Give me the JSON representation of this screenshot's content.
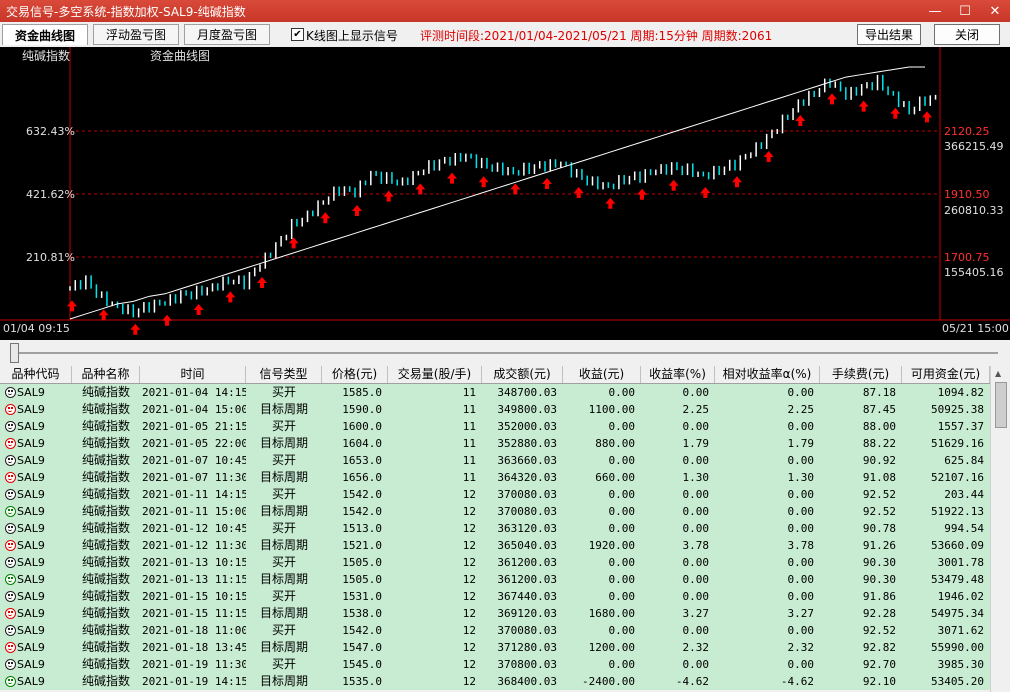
{
  "window": {
    "title": "交易信号-多空系统-指数加权-SAL9-纯碱指数",
    "minimize": "—",
    "maximize": "☐",
    "close": "✕"
  },
  "toolbar": {
    "tabs": [
      {
        "label": "资金曲线图"
      },
      {
        "label": "浮动盈亏图"
      },
      {
        "label": "月度盈亏图"
      }
    ],
    "checkbox_checked": "✔",
    "checkbox_label": "K线图上显示信号",
    "period_info": "评测时间段:2021/01/04-2021/05/21  周期:15分钟  周期数:2061",
    "export_label": "导出结果",
    "close_label": "关闭"
  },
  "chart": {
    "left_title": "纯碱指数",
    "center_title": "资金曲线图",
    "left_ticks": [
      "632.43%",
      "421.62%",
      "210.81%"
    ],
    "right_price_ticks": [
      "2120.25",
      "1910.50",
      "1700.75"
    ],
    "right_equity_ticks": [
      "366215.49",
      "260810.33",
      "155405.16"
    ],
    "start_label": "01/04 09:15",
    "end_label": "05/21 15:00",
    "colors": {
      "up": "#ffffff",
      "down": "#00e5ee",
      "equity": "#ffffff",
      "grid": "#c00000",
      "signal": "#ff0000"
    }
  },
  "chart_data": {
    "type": "line",
    "series": [
      {
        "values": [
          1585,
          1605,
          1560,
          1535,
          1520,
          1535,
          1545,
          1565,
          1575,
          1590,
          1610,
          1600,
          1650,
          1700,
          1760,
          1790,
          1830,
          1860,
          1850,
          1900,
          1890,
          1880,
          1910,
          1930,
          1940,
          1950,
          1930,
          1920,
          1910,
          1920,
          1925,
          1930,
          1900,
          1880,
          1870,
          1890,
          1895,
          1910,
          1920,
          1915,
          1900,
          1915,
          1930,
          1960,
          2000,
          2050,
          2100,
          2130,
          2160,
          2120,
          2140,
          2160,
          2120,
          2080,
          2110
        ]
      },
      {
        "values": [
          0.0,
          0.02,
          0.04,
          0.06,
          0.07,
          0.09,
          0.1,
          0.12,
          0.14,
          0.16,
          0.18,
          0.2,
          0.22,
          0.24,
          0.26,
          0.28,
          0.3,
          0.32,
          0.34,
          0.36,
          0.38,
          0.4,
          0.42,
          0.44,
          0.46,
          0.48,
          0.5,
          0.52,
          0.54,
          0.56,
          0.58,
          0.6,
          0.62,
          0.64,
          0.66,
          0.68,
          0.7,
          0.72,
          0.74,
          0.76,
          0.78,
          0.8,
          0.82,
          0.84,
          0.86,
          0.88,
          0.9,
          0.92,
          0.94,
          0.96,
          0.97,
          0.98,
          0.99,
          1.0,
          1.0
        ]
      }
    ],
    "xlabel": "",
    "ylabel": ""
  },
  "table": {
    "headers": [
      "品种代码",
      "品种名称",
      "时间",
      "信号类型",
      "价格(元)",
      "交易量(股/手)",
      "成交额(元)",
      "收益(元)",
      "收益率(%)",
      "相对收益率α(%)",
      "手续费(元)",
      "可用资金(元)"
    ],
    "rows": [
      {
        "face": "black",
        "code": "SAL9",
        "name": "纯碱指数",
        "time": "2021-01-04 14:15",
        "type": "买开",
        "price": "1585.0",
        "qty": "11",
        "amount": "348700.03",
        "profit": "0.00",
        "rate": "0.00",
        "alpha": "0.00",
        "fee": "87.18",
        "cash": "1094.82"
      },
      {
        "face": "red",
        "code": "SAL9",
        "name": "纯碱指数",
        "time": "2021-01-04 15:00",
        "type": "目标周期",
        "price": "1590.0",
        "qty": "11",
        "amount": "349800.03",
        "profit": "1100.00",
        "rate": "2.25",
        "alpha": "2.25",
        "fee": "87.45",
        "cash": "50925.38"
      },
      {
        "face": "black",
        "code": "SAL9",
        "name": "纯碱指数",
        "time": "2021-01-05 21:15",
        "type": "买开",
        "price": "1600.0",
        "qty": "11",
        "amount": "352000.03",
        "profit": "0.00",
        "rate": "0.00",
        "alpha": "0.00",
        "fee": "88.00",
        "cash": "1557.37"
      },
      {
        "face": "red",
        "code": "SAL9",
        "name": "纯碱指数",
        "time": "2021-01-05 22:00",
        "type": "目标周期",
        "price": "1604.0",
        "qty": "11",
        "amount": "352880.03",
        "profit": "880.00",
        "rate": "1.79",
        "alpha": "1.79",
        "fee": "88.22",
        "cash": "51629.16"
      },
      {
        "face": "black",
        "code": "SAL9",
        "name": "纯碱指数",
        "time": "2021-01-07 10:45",
        "type": "买开",
        "price": "1653.0",
        "qty": "11",
        "amount": "363660.03",
        "profit": "0.00",
        "rate": "0.00",
        "alpha": "0.00",
        "fee": "90.92",
        "cash": "625.84"
      },
      {
        "face": "red",
        "code": "SAL9",
        "name": "纯碱指数",
        "time": "2021-01-07 11:30",
        "type": "目标周期",
        "price": "1656.0",
        "qty": "11",
        "amount": "364320.03",
        "profit": "660.00",
        "rate": "1.30",
        "alpha": "1.30",
        "fee": "91.08",
        "cash": "52107.16"
      },
      {
        "face": "black",
        "code": "SAL9",
        "name": "纯碱指数",
        "time": "2021-01-11 14:15",
        "type": "买开",
        "price": "1542.0",
        "qty": "12",
        "amount": "370080.03",
        "profit": "0.00",
        "rate": "0.00",
        "alpha": "0.00",
        "fee": "92.52",
        "cash": "203.44"
      },
      {
        "face": "green",
        "code": "SAL9",
        "name": "纯碱指数",
        "time": "2021-01-11 15:00",
        "type": "目标周期",
        "price": "1542.0",
        "qty": "12",
        "amount": "370080.03",
        "profit": "0.00",
        "rate": "0.00",
        "alpha": "0.00",
        "fee": "92.52",
        "cash": "51922.13"
      },
      {
        "face": "black",
        "code": "SAL9",
        "name": "纯碱指数",
        "time": "2021-01-12 10:45",
        "type": "买开",
        "price": "1513.0",
        "qty": "12",
        "amount": "363120.03",
        "profit": "0.00",
        "rate": "0.00",
        "alpha": "0.00",
        "fee": "90.78",
        "cash": "994.54"
      },
      {
        "face": "red",
        "code": "SAL9",
        "name": "纯碱指数",
        "time": "2021-01-12 11:30",
        "type": "目标周期",
        "price": "1521.0",
        "qty": "12",
        "amount": "365040.03",
        "profit": "1920.00",
        "rate": "3.78",
        "alpha": "3.78",
        "fee": "91.26",
        "cash": "53660.09"
      },
      {
        "face": "black",
        "code": "SAL9",
        "name": "纯碱指数",
        "time": "2021-01-13 10:15",
        "type": "买开",
        "price": "1505.0",
        "qty": "12",
        "amount": "361200.03",
        "profit": "0.00",
        "rate": "0.00",
        "alpha": "0.00",
        "fee": "90.30",
        "cash": "3001.78"
      },
      {
        "face": "green",
        "code": "SAL9",
        "name": "纯碱指数",
        "time": "2021-01-13 11:15",
        "type": "目标周期",
        "price": "1505.0",
        "qty": "12",
        "amount": "361200.03",
        "profit": "0.00",
        "rate": "0.00",
        "alpha": "0.00",
        "fee": "90.30",
        "cash": "53479.48"
      },
      {
        "face": "black",
        "code": "SAL9",
        "name": "纯碱指数",
        "time": "2021-01-15 10:15",
        "type": "买开",
        "price": "1531.0",
        "qty": "12",
        "amount": "367440.03",
        "profit": "0.00",
        "rate": "0.00",
        "alpha": "0.00",
        "fee": "91.86",
        "cash": "1946.02"
      },
      {
        "face": "red",
        "code": "SAL9",
        "name": "纯碱指数",
        "time": "2021-01-15 11:15",
        "type": "目标周期",
        "price": "1538.0",
        "qty": "12",
        "amount": "369120.03",
        "profit": "1680.00",
        "rate": "3.27",
        "alpha": "3.27",
        "fee": "92.28",
        "cash": "54975.34"
      },
      {
        "face": "black",
        "code": "SAL9",
        "name": "纯碱指数",
        "time": "2021-01-18 11:00",
        "type": "买开",
        "price": "1542.0",
        "qty": "12",
        "amount": "370080.03",
        "profit": "0.00",
        "rate": "0.00",
        "alpha": "0.00",
        "fee": "92.52",
        "cash": "3071.62"
      },
      {
        "face": "red",
        "code": "SAL9",
        "name": "纯碱指数",
        "time": "2021-01-18 13:45",
        "type": "目标周期",
        "price": "1547.0",
        "qty": "12",
        "amount": "371280.03",
        "profit": "1200.00",
        "rate": "2.32",
        "alpha": "2.32",
        "fee": "92.82",
        "cash": "55990.00"
      },
      {
        "face": "black",
        "code": "SAL9",
        "name": "纯碱指数",
        "time": "2021-01-19 11:30",
        "type": "买开",
        "price": "1545.0",
        "qty": "12",
        "amount": "370800.03",
        "profit": "0.00",
        "rate": "0.00",
        "alpha": "0.00",
        "fee": "92.70",
        "cash": "3985.30"
      },
      {
        "face": "green",
        "code": "SAL9",
        "name": "纯碱指数",
        "time": "2021-01-19 14:15",
        "type": "目标周期",
        "price": "1535.0",
        "qty": "12",
        "amount": "368400.03",
        "profit": "-2400.00",
        "rate": "-4.62",
        "alpha": "-4.62",
        "fee": "92.10",
        "cash": "53405.20"
      }
    ]
  }
}
